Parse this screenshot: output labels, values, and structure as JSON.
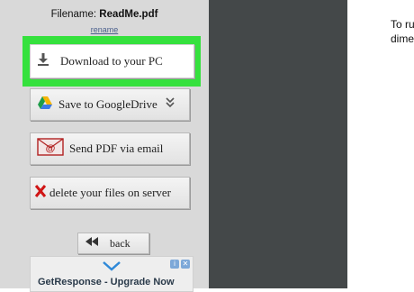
{
  "file": {
    "label": "Filename:",
    "name": "ReadMe.pdf",
    "rename": "rename"
  },
  "actions": {
    "download": "Download to your PC",
    "gdrive": "Save to GoogleDrive",
    "email": "Send PDF via email",
    "delete": "delete your files on server",
    "back": "back"
  },
  "ad": {
    "text": "GetResponse - Upgrade Now"
  },
  "right_text": {
    "line1": "To ru",
    "line2": "dime"
  },
  "colors": {
    "highlight": "#35e13d",
    "dark_panel": "#444849",
    "panel": "#d9d9d9"
  },
  "icons": [
    "download-icon",
    "google-drive-icon",
    "chevron-down-icon",
    "email-icon",
    "delete-x-icon",
    "rewind-icon",
    "ad-info-icon",
    "ad-close-icon",
    "ad-mail-icon"
  ]
}
